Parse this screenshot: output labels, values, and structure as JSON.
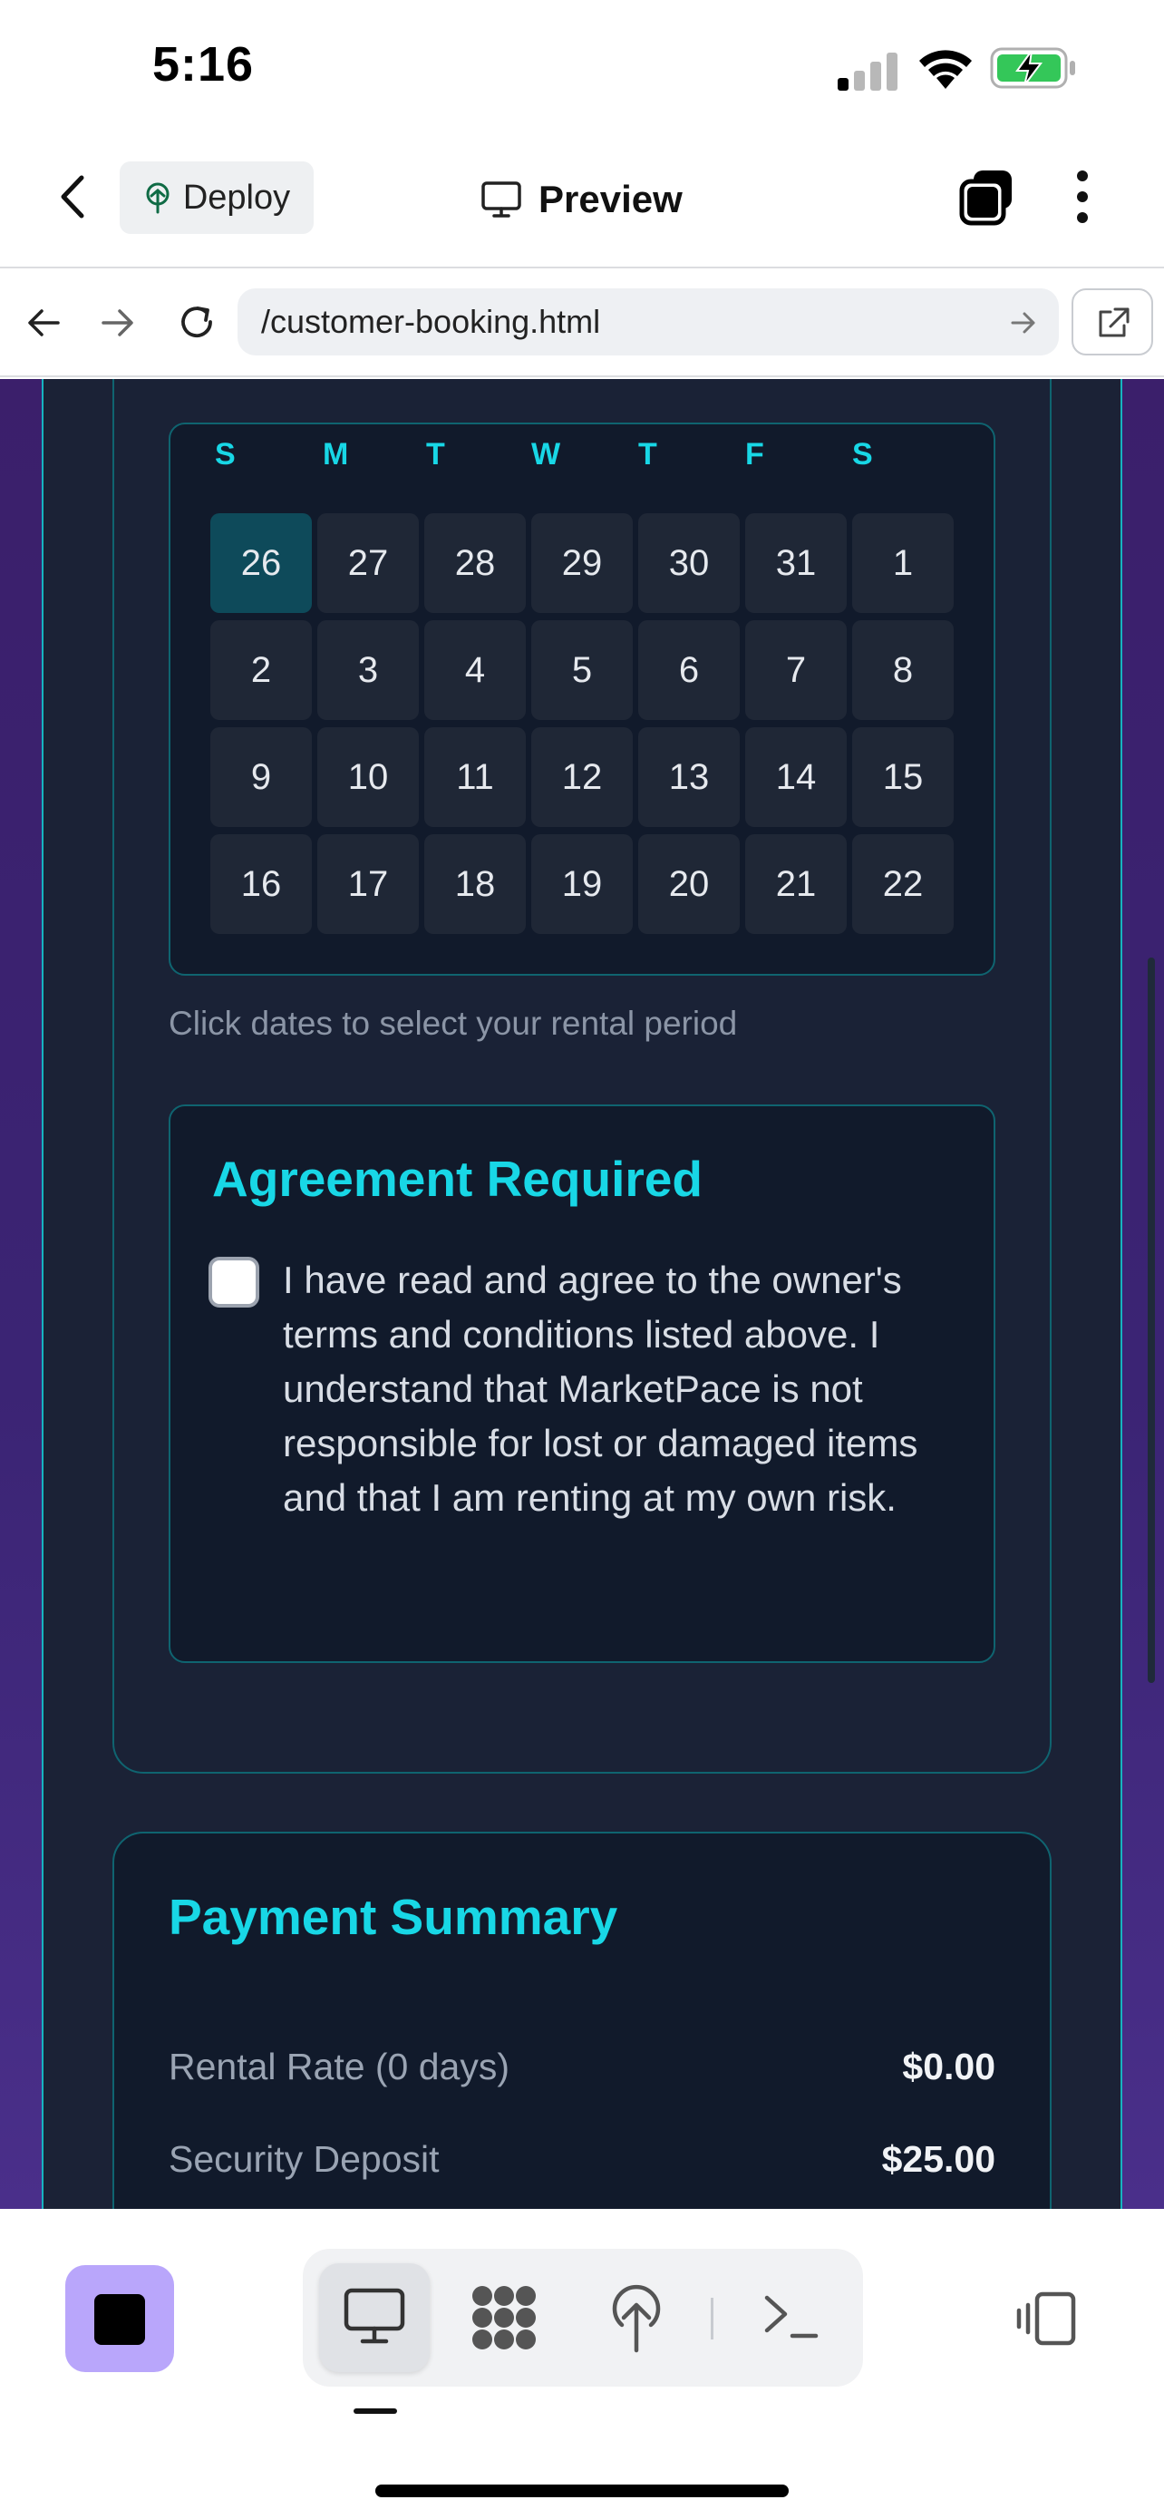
{
  "status_bar": {
    "time": "5:16"
  },
  "header": {
    "deploy_label": "Deploy",
    "preview_label": "Preview"
  },
  "browser": {
    "url": "/customer-booking.html"
  },
  "calendar": {
    "weekdays": [
      "S",
      "M",
      "T",
      "W",
      "T",
      "F",
      "S"
    ],
    "selected": "26",
    "weeks": [
      [
        "26",
        "27",
        "28",
        "29",
        "30",
        "31",
        "1"
      ],
      [
        "2",
        "3",
        "4",
        "5",
        "6",
        "7",
        "8"
      ],
      [
        "9",
        "10",
        "11",
        "12",
        "13",
        "14",
        "15"
      ],
      [
        "16",
        "17",
        "18",
        "19",
        "20",
        "21",
        "22"
      ]
    ],
    "hint": "Click dates to select your rental period"
  },
  "agreement": {
    "title": "Agreement Required",
    "text": "I have read and agree to the owner's terms and conditions listed above. I understand that MarketPace is not responsible for lost or damaged items and that I am renting at my own risk.",
    "checked": false
  },
  "payment": {
    "title": "Payment Summary",
    "rows": [
      {
        "label": "Rental Rate (0 days)",
        "value": "$0.00"
      },
      {
        "label": "Security Deposit",
        "value": "$25.00"
      }
    ]
  },
  "colors": {
    "accent": "#18d7e6",
    "stop_button": "#b9a6fb",
    "battery": "#34c759"
  }
}
